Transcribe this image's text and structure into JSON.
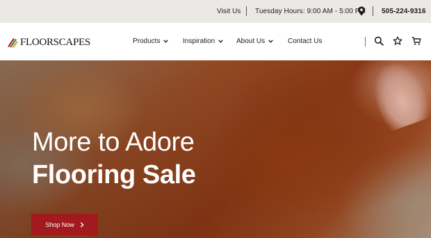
{
  "topbar": {
    "visit_label": "Visit Us",
    "hours_label": "Tuesday Hours: 9:00 AM - 5:00 PM",
    "location_icon": "map-pin-icon",
    "phone": "505-224-9316"
  },
  "header": {
    "logo_text": "FLOORSCAPES",
    "nav": [
      {
        "label": "Products",
        "has_dropdown": true
      },
      {
        "label": "Inspiration",
        "has_dropdown": true
      },
      {
        "label": "About Us",
        "has_dropdown": true
      },
      {
        "label": "Contact Us",
        "has_dropdown": false
      }
    ],
    "icons": [
      "search-icon",
      "star-icon",
      "cart-icon"
    ]
  },
  "hero": {
    "title": "More to Adore",
    "subtitle": "Flooring Sale",
    "cta_label": "Shop Now"
  },
  "colors": {
    "topbar_bg": "#ebe9e6",
    "cta_bg": "#a21a1d",
    "logo_accent_red": "#b3252a",
    "logo_accent_green": "#3d7a3a"
  }
}
